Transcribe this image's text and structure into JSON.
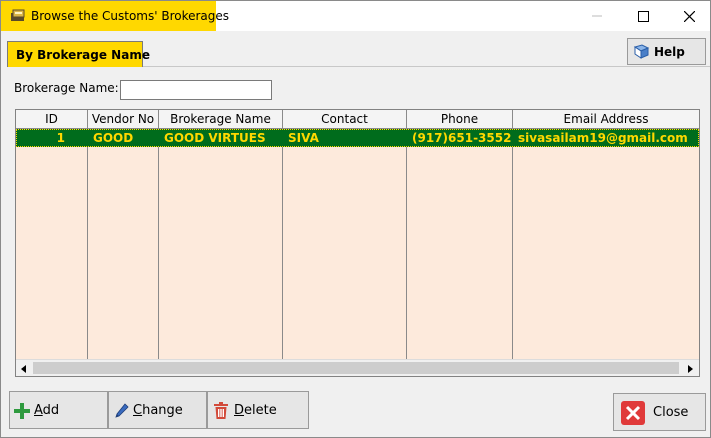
{
  "window": {
    "title": "Browse the Customs' Brokerages"
  },
  "tabs": [
    {
      "label": "By Brokerage Name"
    }
  ],
  "toolbar": {
    "help_label": "Help"
  },
  "search": {
    "label": "Brokerage Name:",
    "value": "",
    "placeholder": ""
  },
  "table": {
    "columns": [
      "ID",
      "Vendor No",
      "Brokerage Name",
      "Contact",
      "Phone",
      "Email Address"
    ],
    "rows": [
      {
        "id": "1",
        "vendor_no": "GOOD",
        "brokerage_name": "GOOD VIRTUES",
        "contact": "SIVA",
        "phone": "(917)651-3552",
        "email": "sivasailam19@gmail.com"
      }
    ]
  },
  "actions": {
    "add_first": "A",
    "add_rest": "dd",
    "change_first": "C",
    "change_rest": "hange",
    "delete_first": "D",
    "delete_rest": "elete",
    "close": "Close"
  },
  "colors": {
    "title_highlight": "#ffd800",
    "selected_row_bg": "#006c1c",
    "selected_row_text": "#ffd800",
    "grid_bg": "#fdeadc"
  }
}
